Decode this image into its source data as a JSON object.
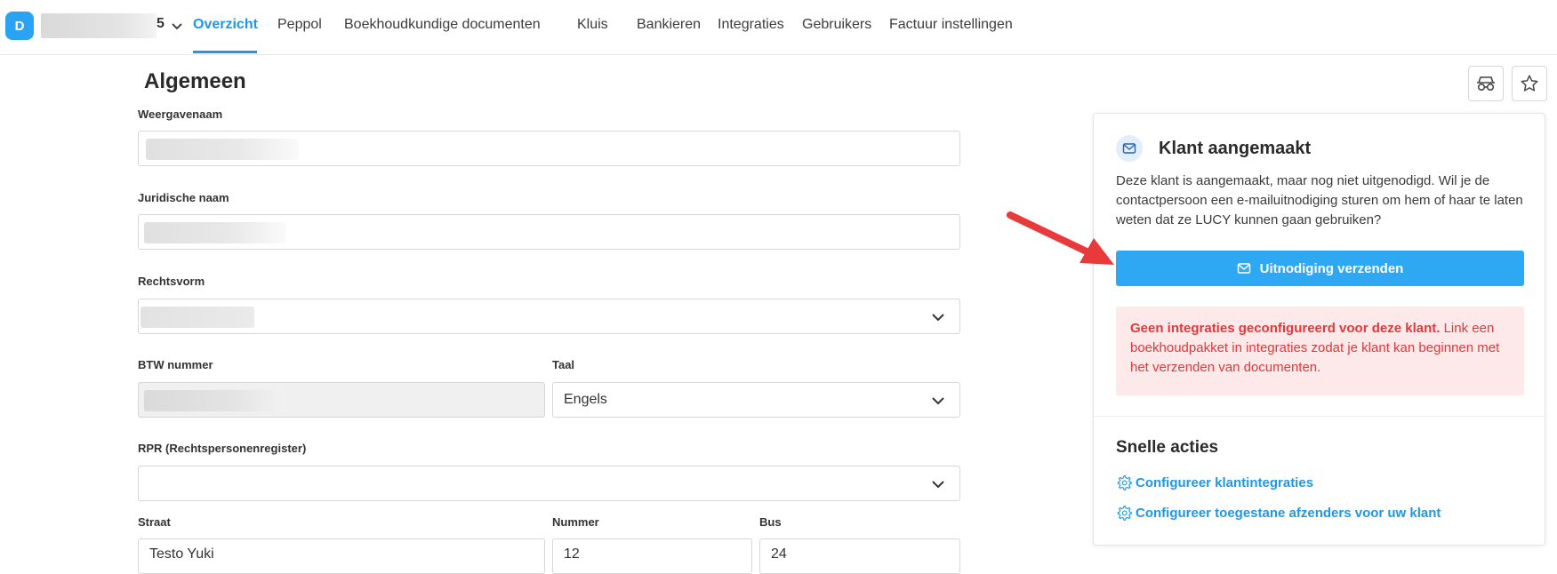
{
  "topbar": {
    "avatar_letter": "D",
    "org_name_suffix": "5",
    "nav": [
      {
        "label": "Overzicht",
        "active": true
      },
      {
        "label": "Peppol"
      },
      {
        "label": "Boekhoudkundige documenten"
      },
      {
        "label": "Kluis"
      },
      {
        "label": "Bankieren"
      },
      {
        "label": "Integraties"
      },
      {
        "label": "Gebruikers"
      },
      {
        "label": "Factuur instellingen"
      }
    ]
  },
  "form": {
    "title": "Algemeen",
    "display_name_label": "Weergavenaam",
    "legal_name_label": "Juridische naam",
    "legal_form_label": "Rechtsvorm",
    "vat_label": "BTW nummer",
    "language_label": "Taal",
    "language_value": "Engels",
    "rpr_label": "RPR (Rechtspersonenregister)",
    "street_label": "Straat",
    "street_value": "Testo Yuki",
    "number_label": "Nummer",
    "number_value": "12",
    "bus_label": "Bus",
    "bus_value": "24"
  },
  "side_card": {
    "title": "Klant aangemaakt",
    "text": "Deze klant is aangemaakt, maar nog niet uitgenodigd. Wil je de contactpersoon een e-mailuitnodiging sturen om hem of haar te laten weten dat ze LUCY kunnen gaan gebruiken?",
    "invite_button": "Uitnodiging verzenden",
    "alert_bold": "Geen integraties geconfigureerd voor deze klant.",
    "alert_text": " Link een boekhoudpakket in integraties zodat je klant kan beginnen met het verzenden van documenten.",
    "quick_actions_title": "Snelle acties",
    "quick_links": [
      "Configureer klantintegraties",
      "Configureer toegestane afzenders voor uw klant"
    ]
  },
  "colors": {
    "accent": "#1e98e6",
    "button": "#2ea8f2",
    "alert_bg": "#fde9e9",
    "alert_text": "#e0393b",
    "annotation_arrow": "#e8393b"
  },
  "icons": [
    "chevron-down-icon",
    "glasses-icon",
    "star-icon",
    "mail-icon",
    "gear-icon",
    "annotation-arrow"
  ]
}
